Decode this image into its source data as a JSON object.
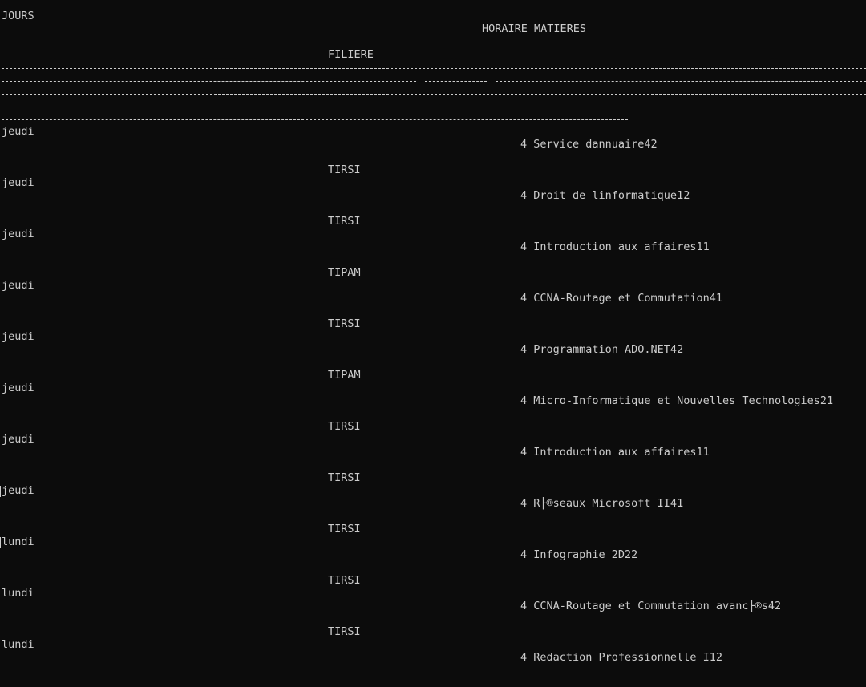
{
  "header": {
    "col_jours": "JOURS",
    "col_horaire_matieres": "HORAIRE MATIERES",
    "col_filiere": "FILIERE"
  },
  "rows": [
    {
      "jour": "jeudi",
      "matiere": "4 Service dannuaire42",
      "filiere": "TIRSI"
    },
    {
      "jour": "jeudi",
      "matiere": "4 Droit de linformatique12",
      "filiere": "TIRSI"
    },
    {
      "jour": "jeudi",
      "matiere": "4 Introduction aux affaires11",
      "filiere": "TIPAM"
    },
    {
      "jour": "jeudi",
      "matiere": "4 CCNA-Routage et Commutation41",
      "filiere": "TIRSI"
    },
    {
      "jour": "jeudi",
      "matiere": "4 Programmation ADO.NET42",
      "filiere": "TIPAM"
    },
    {
      "jour": "jeudi",
      "matiere": "4 Micro-Informatique et Nouvelles Technologies21",
      "filiere": "TIRSI"
    },
    {
      "jour": "jeudi",
      "matiere": "4 Introduction aux affaires11",
      "filiere": "TIRSI"
    },
    {
      "jour": "jeudi",
      "matiere": "4 R├®seaux Microsoft II41",
      "filiere": "TIRSI"
    },
    {
      "jour": "lundi",
      "matiere": "4 Infographie 2D22",
      "filiere": "TIRSI"
    },
    {
      "jour": "lundi",
      "matiere": "4 CCNA-Routage et Commutation avanc├®s42",
      "filiere": "TIRSI"
    },
    {
      "jour": "lundi",
      "matiere": "4 Redaction Professionnelle I12"
    }
  ]
}
